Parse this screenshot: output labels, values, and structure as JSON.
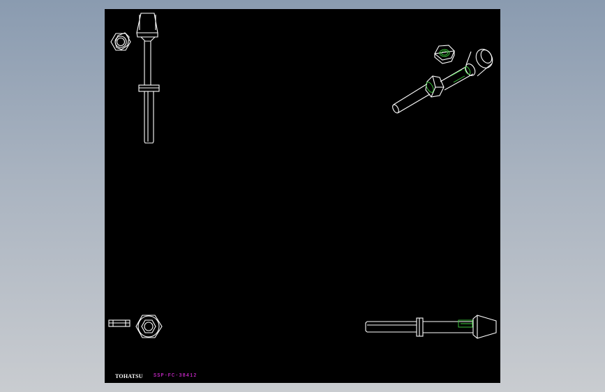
{
  "drawing": {
    "brand": "TOHATSU",
    "part_code": "SSP-FC-38412"
  },
  "colors": {
    "background": "#000000",
    "outline": "#ffffff",
    "hidden_detail": "#3fd43f",
    "part_code_text": "#ff33ff"
  }
}
